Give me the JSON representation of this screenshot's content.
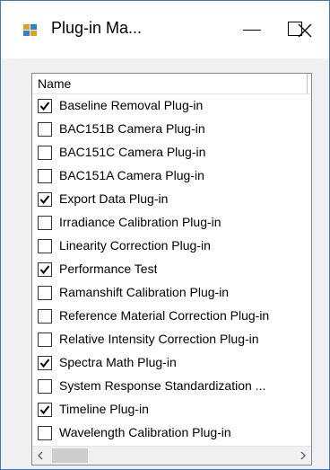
{
  "window": {
    "title": "Plug-in Ma..."
  },
  "list": {
    "column_header": "Name",
    "items": [
      {
        "label": "Baseline Removal Plug-in",
        "checked": true
      },
      {
        "label": "BAC151B Camera Plug-in",
        "checked": false
      },
      {
        "label": "BAC151C Camera Plug-in",
        "checked": false
      },
      {
        "label": "BAC151A Camera Plug-in",
        "checked": false
      },
      {
        "label": "Export Data Plug-in",
        "checked": true
      },
      {
        "label": "Irradiance Calibration Plug-in",
        "checked": false
      },
      {
        "label": "Linearity Correction Plug-in",
        "checked": false
      },
      {
        "label": "Performance Test",
        "checked": true
      },
      {
        "label": "Ramanshift Calibration Plug-in",
        "checked": false
      },
      {
        "label": "Reference Material Correction Plug-in",
        "checked": false
      },
      {
        "label": "Relative Intensity Correction Plug-in",
        "checked": false
      },
      {
        "label": "Spectra Math Plug-in",
        "checked": true
      },
      {
        "label": "System Response Standardization ...",
        "checked": false
      },
      {
        "label": "Timeline Plug-in",
        "checked": true
      },
      {
        "label": "Wavelength Calibration Plug-in",
        "checked": false
      }
    ]
  },
  "colors": {
    "window_border": "#3c78c8",
    "background": "#f0f0f0",
    "list_border": "#828790"
  }
}
